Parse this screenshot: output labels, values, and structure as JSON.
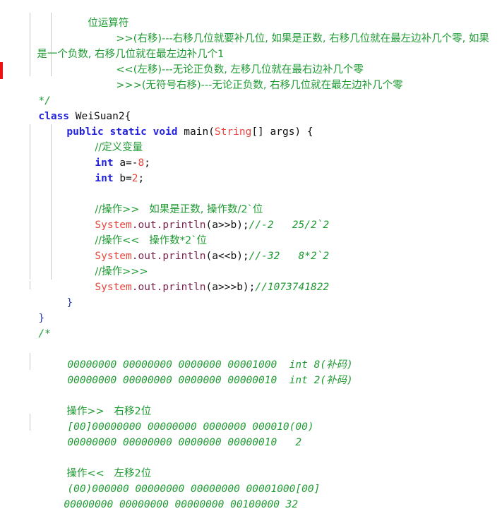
{
  "editor": {
    "language": "Java",
    "class_name": "WeiSuan2",
    "colors": {
      "comment": "#1f9b33",
      "keyword": "#2222dd",
      "type_literal": "#e8463c",
      "plain_text": "#101010",
      "brace": "#2b3ea8",
      "member": "#7a2550",
      "error_marker": "#ee1111",
      "indent_guide": "#c8c8c8",
      "background": "#ffffff"
    }
  },
  "header_comment": {
    "title": "位运算符",
    "line_right_shift_a": ">>(右移)---右移几位就要补几位, 如果是正数, 右移几位就在最左边补几个零, 如果",
    "line_right_shift_b": "是一个负数, 右移几位就在最左边补几个1",
    "line_left_shift": "<<(左移)---无论正负数, 左移几位就在最右边补几个零",
    "line_unsigned_shift": ">>>(无符号右移)---无论正负数, 右移几位就在最左边补几个零",
    "close": "*/"
  },
  "code": {
    "class_decl_kw": "class",
    "class_decl_name": " WeiSuan2{",
    "method_kw1": "public static void",
    "method_name": " main(",
    "method_param_type": "String",
    "method_param_rest": "[] args) {",
    "comment_define_vars": "//定义变量",
    "decl_a_kw": "int",
    "decl_a_name": " a=-",
    "decl_a_value": "8",
    "decl_a_semi": ";",
    "decl_b_kw": "int",
    "decl_b_name": " b=",
    "decl_b_value": "2",
    "decl_b_semi": ";",
    "comment_op_rshift": "//操作>>   如果是正数, 操作数/2`位",
    "print1_system": "System",
    "print1_member": ".out.println",
    "print1_args": "(a>>b);",
    "print1_comment": "//-2   25/2`2",
    "comment_op_lshift": "//操作<<   操作数*2`位",
    "print2_system": "System",
    "print2_member": ".out.println",
    "print2_args": "(a<<b);",
    "print2_comment": "//-32   8*2`2",
    "comment_op_urshift": "//操作>>>",
    "print3_system": "System",
    "print3_member": ".out.println",
    "print3_args": "(a>>>b);",
    "print3_comment": "//1073741822",
    "close_method_brace": "}",
    "close_class_brace": "}"
  },
  "trailing_comment": {
    "open": "/*",
    "binary_int8": "00000000 00000000 0000000 00001000  int 8(补码)",
    "binary_int2": "00000000 00000000 0000000 00000010  int 2(补码)",
    "heading_rshift": "操作>>   右移2位",
    "rshift_before": "[00]00000000 00000000 0000000 000010(00)",
    "rshift_after": "00000000 00000000 0000000 00000010   2",
    "heading_lshift": "操作<<   左移2位",
    "lshift_before": "(00)000000 00000000 00000000 00001000[00]",
    "lshift_after": "00000000 00000000 00000000 00100000 32"
  }
}
